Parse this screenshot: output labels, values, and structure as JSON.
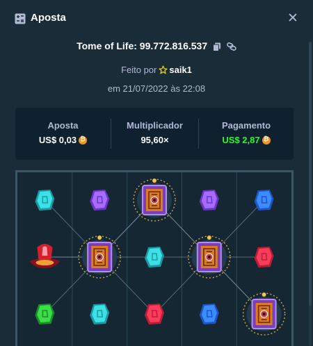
{
  "header": {
    "title": "Aposta",
    "icon": "bet-slip-icon",
    "close_icon": "close-icon",
    "close_glyph": "✕"
  },
  "game": {
    "line": "Tome of Life: 99.772.816.537"
  },
  "meta": {
    "made_by_prefix": "Feito por",
    "username": "saik1",
    "date": "em 21/07/2022 às 22:08"
  },
  "stats": {
    "bet_label": "Aposta",
    "bet_value": "US$ 0,03",
    "multiplier_label": "Multiplicador",
    "multiplier_value": "95,60×",
    "payout_label": "Pagamento",
    "payout_value": "US$ 2,87"
  },
  "colors": {
    "payout": "#1fff20",
    "coin": "#f7931a",
    "background": "#1a2c38",
    "panel": "#0f212e"
  },
  "board": {
    "columns": 5,
    "rows": 3,
    "grid": [
      [
        "cyan-gem",
        "purple-gem",
        "book-scatter",
        "purple-gem",
        "blue-gem"
      ],
      [
        "red-chalice",
        "book-scatter",
        "cyan-gem",
        "book-scatter",
        "red-gem"
      ],
      [
        "green-gem",
        "cyan-gem",
        "red-gem",
        "blue-gem",
        "book-scatter"
      ]
    ],
    "paylines": [
      {
        "cells": [
          [
            1,
            0
          ],
          [
            1,
            1
          ],
          [
            0,
            2
          ],
          [
            1,
            3
          ],
          [
            2,
            4
          ]
        ]
      },
      {
        "cells": [
          [
            1,
            0
          ],
          [
            1,
            1
          ],
          [
            1,
            2
          ],
          [
            1,
            3
          ],
          [
            1,
            4
          ]
        ]
      },
      {
        "cells": [
          [
            0,
            0
          ],
          [
            1,
            1
          ],
          [
            2,
            2
          ],
          [
            1,
            3
          ],
          [
            0,
            4
          ]
        ]
      },
      {
        "cells": [
          [
            2,
            0
          ],
          [
            1,
            1
          ],
          [
            0,
            2
          ],
          [
            1,
            3
          ],
          [
            2,
            4
          ]
        ]
      }
    ]
  }
}
